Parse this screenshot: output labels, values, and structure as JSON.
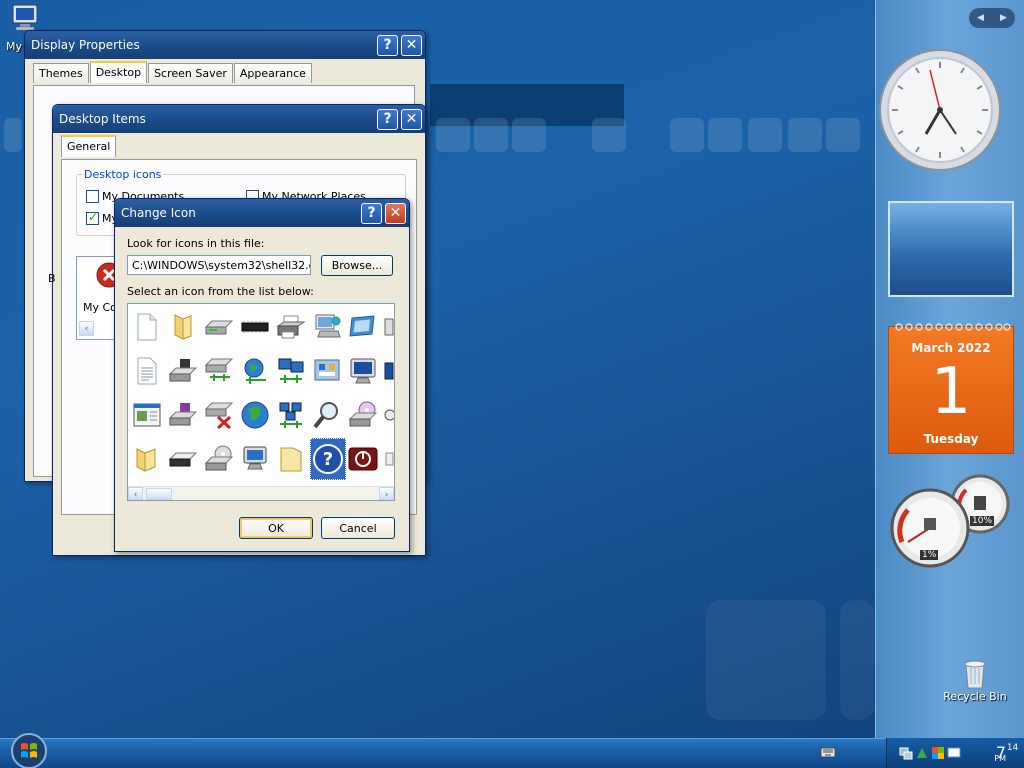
{
  "desktop": {
    "my_computer_label": "My",
    "recycle_bin_label": "Recycle Bin"
  },
  "display_properties": {
    "title": "Display Properties",
    "help_glyph": "?",
    "close_glyph": "✕",
    "tabs": [
      {
        "label": "Themes",
        "active": false
      },
      {
        "label": "Desktop",
        "active": true
      },
      {
        "label": "Screen Saver",
        "active": false
      },
      {
        "label": "Appearance",
        "active": false
      }
    ]
  },
  "desktop_items": {
    "title": "Desktop Items",
    "help_glyph": "?",
    "close_glyph": "✕",
    "tab_general": "General",
    "group_title": "Desktop icons",
    "checkboxes": [
      {
        "label": "My Documents",
        "checked": false
      },
      {
        "label": "My Network Places",
        "checked": false
      },
      {
        "label": "My",
        "checked": true
      }
    ],
    "section_letter": "B",
    "icon_label_partial": "My Co",
    "scroll_left": "‹"
  },
  "change_icon": {
    "title": "Change Icon",
    "help_glyph": "?",
    "close_glyph": "✕",
    "look_for_label": "Look for icons in this file:",
    "file_path": "C:\\WINDOWS\\system32\\shell32.dll",
    "browse_label": "Browse...",
    "select_label": "Select an icon from the list below:",
    "ok_label": "OK",
    "cancel_label": "Cancel",
    "scroll_left": "‹",
    "scroll_right": "›",
    "icons": [
      [
        "document-icon",
        "folder-icon",
        "drive-icon",
        "memory-chip-icon",
        "printer-icon",
        "network-computer-icon",
        "monitor-icon",
        "partial-icon"
      ],
      [
        "text-document-icon",
        "drive-floppy-icon",
        "network-drive-icon",
        "globe-network-icon",
        "network-icon",
        "control-panel-icon",
        "display-icon",
        "partial-icon"
      ],
      [
        "window-app-icon",
        "floppy-drive-icon",
        "disconnected-drive-icon",
        "globe-icon",
        "network-places-icon",
        "search-icon",
        "cd-drive-icon",
        "partial-icon"
      ],
      [
        "open-folder-icon",
        "removable-drive-icon",
        "cd-drive-icon",
        "computer-icon",
        "empty-folder-icon",
        "help-icon",
        "shutdown-icon",
        "partial-icon"
      ]
    ],
    "selected_icon": "help-icon"
  },
  "gadgets": {
    "nav_prev": "◀",
    "nav_next": "▶",
    "calendar_month": "March 2022",
    "calendar_day": "1",
    "calendar_weekday": "Tuesday",
    "cpu_percent": "1%",
    "memory_percent": "10%"
  },
  "taskbar": {
    "time_hour": "7",
    "time_minute": "14",
    "time_ampm": "PM"
  },
  "colors": {
    "accent": "#1d4d8c",
    "calendar_orange": "#f27a25",
    "selection": "#316ac5"
  }
}
